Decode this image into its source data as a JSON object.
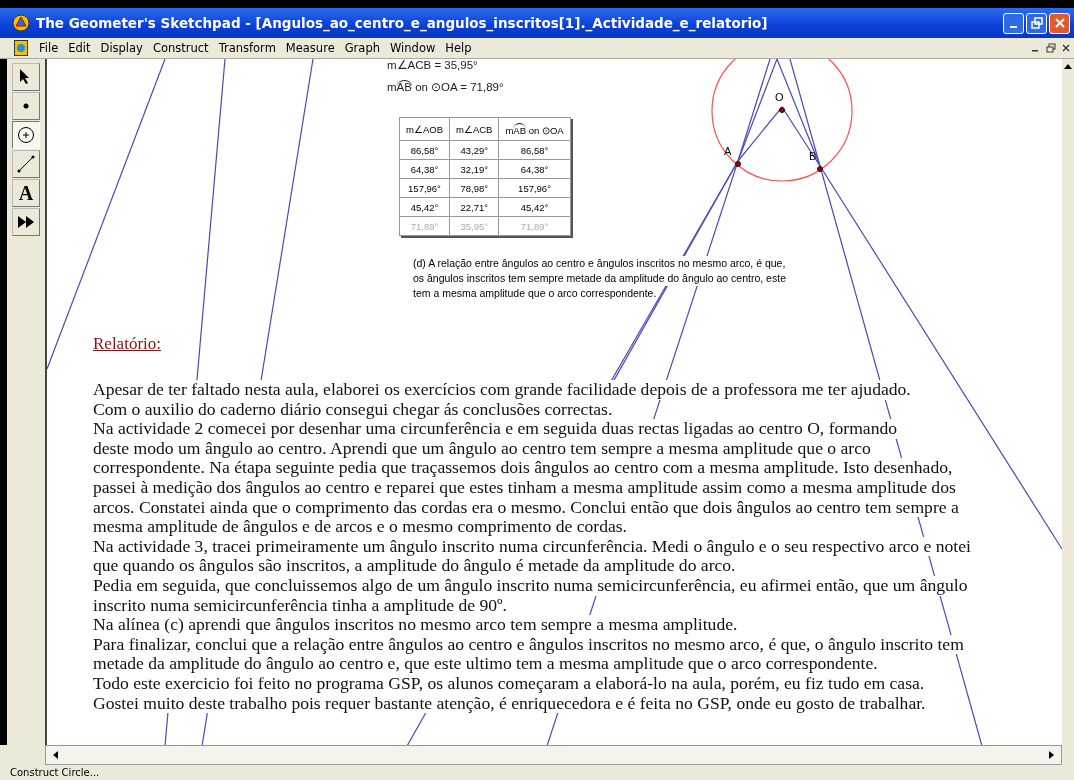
{
  "window": {
    "title": "The Geometer's Sketchpad - [Angulos_ao_centro_e_angulos_inscritos[1]._Actividade_e_relatorio]"
  },
  "menu": [
    "File",
    "Edit",
    "Display",
    "Construct",
    "Transform",
    "Measure",
    "Graph",
    "Window",
    "Help"
  ],
  "tools": [
    {
      "kind": "arrow",
      "selected": false
    },
    {
      "kind": "point",
      "selected": false
    },
    {
      "kind": "compass",
      "selected": true
    },
    {
      "kind": "segment",
      "selected": false
    },
    {
      "kind": "text",
      "label": "A",
      "selected": false
    },
    {
      "kind": "custom",
      "selected": false
    }
  ],
  "measurements": [
    {
      "prefix": "m∠ACB = 35,95°"
    },
    {
      "prefix": "m",
      "arc": "AB",
      "suffix": "on ⊙OA = 71,89°"
    }
  ],
  "table": {
    "columns": [
      {
        "prefix": "m∠AOB"
      },
      {
        "prefix": "m∠ACB"
      },
      {
        "prefix": "m",
        "arc": "AB",
        "suffix": "on ⊙OA"
      }
    ],
    "rows": [
      {
        "cells": [
          "86,58°",
          "43,29°",
          "86,58°"
        ],
        "dimmed": false
      },
      {
        "cells": [
          "64,38°",
          "32,19°",
          "64,38°"
        ],
        "dimmed": false
      },
      {
        "cells": [
          "157,96°",
          "78,98°",
          "157,96°"
        ],
        "dimmed": false
      },
      {
        "cells": [
          "45,42°",
          "22,71°",
          "45,42°"
        ],
        "dimmed": false
      },
      {
        "cells": [
          "71,89°",
          "35,95°",
          "71,89°"
        ],
        "dimmed": true
      }
    ]
  },
  "points": [
    {
      "label": "O"
    },
    {
      "label": "A"
    },
    {
      "label": "B"
    }
  ],
  "answer_d": [
    "(d) A relação entre ângulos ao centro e ângulos inscritos no mesmo arco, é que,",
    "os ângulos inscritos tem sempre metade da amplitude do ângulo ao centro, este",
    "tem a mesma amplitude que o arco correspondente."
  ],
  "report": {
    "heading": "Relatório:",
    "lines": [
      "Apesar de ter faltado nesta aula, elaborei os exercícios com grande facilidade depois de a professora me ter ajudado.",
      "Com o auxilio do caderno diário consegui chegar ás conclusões correctas.",
      "Na actividade 2 comecei por desenhar uma circunferência e em seguida duas rectas ligadas ao centro O, formando",
      "deste modo um ângulo ao centro. Aprendi que um ângulo ao centro tem sempre a mesma amplitude que o arco",
      "correspondente. Na étapa seguinte pedia que traçassemos dois ângulos ao centro com a mesma amplitude. Isto desenhado,",
      "passei à medição dos ângulos ao centro e reparei que estes tinham a mesma amplitude assim como a mesma amplitude dos",
      "arcos. Constatei ainda que o comprimento das cordas era o mesmo. Conclui então que dois ângulos ao centro tem sempre a",
      "mesma amplitude de ângulos e de arcos e o mesmo comprimento de cordas.",
      "Na actividade 3, tracei primeiramente um ângulo inscrito numa circunferência. Medi o ângulo e o seu respectivo arco e notei",
      "que quando os ângulos são inscritos, a amplitude do ângulo é metade da amplitude do arco.",
      "Pedia em seguida, que concluissemos algo de um ângulo inscrito numa semicircunferência, eu afirmei então, que um ângulo",
      "inscrito numa semicircunferência tinha a amplitude de 90º.",
      "Na alínea (c) aprendi que ângulos inscritos no mesmo arco tem sempre a mesma amplitude.",
      "Para finalizar, conclui que a relação entre ângulos ao centro e ângulos inscritos no mesmo arco, é que, o ângulo inscrito tem",
      "metade da amplitude do ângulo ao centro e, que este ultimo tem a mesma amplitude que o arco correspondente.",
      "Todo este exercicio foi feito no programa GSP, os alunos começaram a elaborá-lo na aula, porém, eu fiz tudo em casa.",
      "Gostei muito deste trabalho pois requer bastante atenção, é enriquecedora e é feita no GSP, onde eu gosto de trabalhar."
    ]
  },
  "status_bar": "Construct Circle..."
}
